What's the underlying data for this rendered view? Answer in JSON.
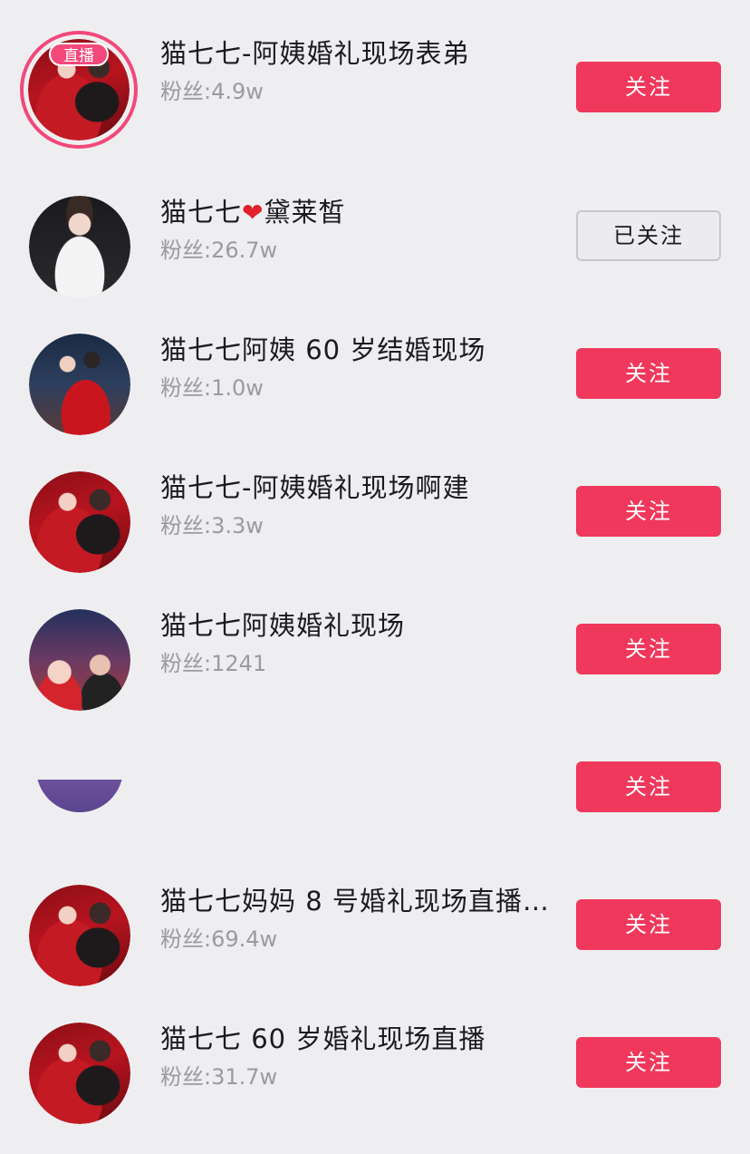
{
  "live_badge": "直播",
  "heart_glyph": "❤",
  "accounts": [
    {
      "name": "猫七七-阿姨婚礼现场表弟",
      "fans": "粉丝:4.9w",
      "button": "关注",
      "avatar": "red-dress"
    },
    {
      "name_prefix": "猫七七",
      "name_suffix": "黛莱皙",
      "fans": "粉丝:26.7w",
      "button": "已关注",
      "avatar": "white-suit"
    },
    {
      "name": "猫七七阿姨 60 岁结婚现场",
      "fans": "粉丝:1.0w",
      "button": "关注",
      "avatar": "city-night"
    },
    {
      "name": "猫七七-阿姨婚礼现场啊建",
      "fans": "粉丝:3.3w",
      "button": "关注",
      "avatar": "red-dress"
    },
    {
      "name": "猫七七阿姨婚礼现场",
      "fans": "粉丝:1241",
      "button": "关注",
      "avatar": "party"
    },
    {
      "name": "",
      "fans": "",
      "button": "关注",
      "avatar": "purple"
    },
    {
      "name": "猫七七妈妈 8 号婚礼现场直播...",
      "fans": "粉丝:69.4w",
      "button": "关注",
      "avatar": "red-dress"
    },
    {
      "name": "猫七七 60 岁婚礼现场直播",
      "fans": "粉丝:31.7w",
      "button": "关注",
      "avatar": "red-dress"
    }
  ],
  "colors": {
    "background": "#eeeef0",
    "follow_button": "#f0385c",
    "live_ring": "#f2487a",
    "name_text": "#1b1b1f",
    "fans_text": "#9a9aa0"
  }
}
